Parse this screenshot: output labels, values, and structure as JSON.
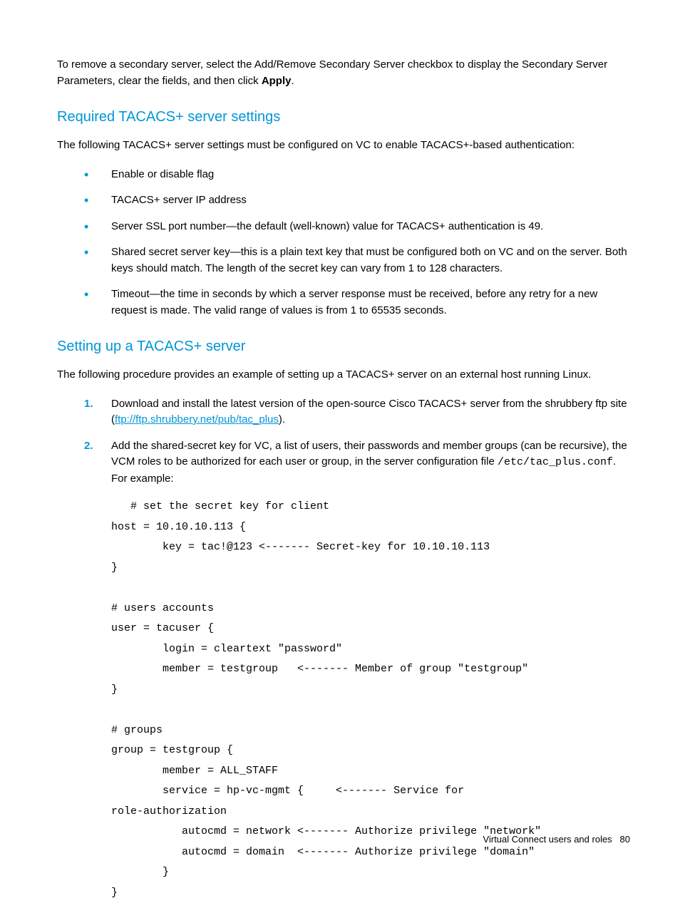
{
  "intro": {
    "p1_part1": "To remove a secondary server, select the Add/Remove Secondary Server checkbox to display the Secondary Server Parameters, clear the fields, and then click ",
    "p1_bold": "Apply",
    "p1_part2": "."
  },
  "section1": {
    "heading": "Required TACACS+ server settings",
    "intro": "The following TACACS+ server settings must be configured on VC to enable TACACS+-based authentication:",
    "bullets": [
      "Enable or disable flag",
      "TACACS+ server IP address",
      "Server SSL port number—the default (well-known) value for TACACS+ authentication is 49.",
      "Shared secret server key—this is a plain text key that must be configured both on VC and on the server. Both keys should match. The length of the secret key can vary from 1 to 128 characters.",
      "Timeout—the time in seconds by which a server response must be received, before any retry for a new request is made. The valid range of values is from 1 to 65535 seconds."
    ]
  },
  "section2": {
    "heading": "Setting up a TACACS+ server",
    "intro": "The following procedure provides an example of setting up a TACACS+ server on an external host running Linux.",
    "step1_part1": "Download and install the latest version of the open-source Cisco TACACS+ server from the shrubbery ftp site (",
    "step1_link": "ftp://ftp.shrubbery.net/pub/tac_plus",
    "step1_part2": ").",
    "step2_part1": "Add the shared-secret key for VC, a list of users, their passwords and member groups (can be recursive), the VCM roles to be authorized for each user or group, in the server configuration file ",
    "step2_mono": "/etc/tac_plus.conf",
    "step2_part2": ". For example:",
    "code": "   # set the secret key for client\nhost = 10.10.10.113 {\n        key = tac!@123 <------- Secret-key for 10.10.10.113\n}\n\n# users accounts\nuser = tacuser {\n        login = cleartext \"password\"\n        member = testgroup   <------- Member of group \"testgroup\"\n}\n\n# groups\ngroup = testgroup {\n        member = ALL_STAFF\n        service = hp-vc-mgmt {     <------- Service for \nrole-authorization\n           autocmd = network <------- Authorize privilege \"network\"\n           autocmd = domain  <------- Authorize privilege \"domain\"\n        }\n}"
  },
  "footer": {
    "text": "Virtual Connect users and roles",
    "page": "80"
  }
}
